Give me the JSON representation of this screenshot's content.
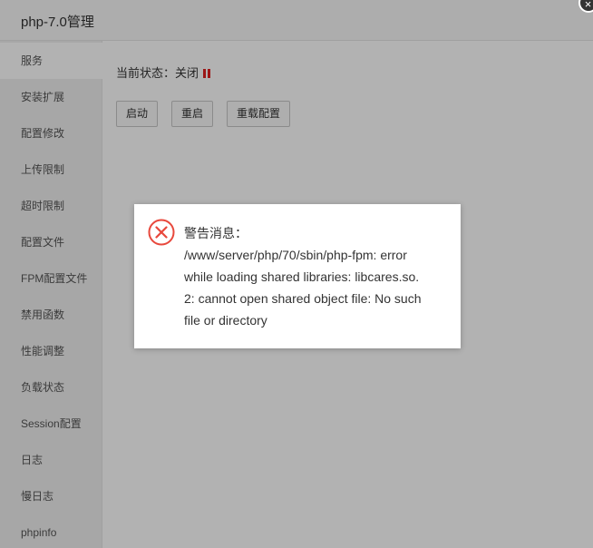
{
  "window": {
    "title": "php-7.0管理",
    "close_label": "×"
  },
  "sidebar": {
    "items": [
      {
        "label": "服务",
        "active": true
      },
      {
        "label": "安装扩展"
      },
      {
        "label": "配置修改"
      },
      {
        "label": "上传限制"
      },
      {
        "label": "超时限制"
      },
      {
        "label": "配置文件"
      },
      {
        "label": "FPM配置文件"
      },
      {
        "label": "禁用函数"
      },
      {
        "label": "性能调整"
      },
      {
        "label": "负载状态"
      },
      {
        "label": "Session配置"
      },
      {
        "label": "日志"
      },
      {
        "label": "慢日志"
      },
      {
        "label": "phpinfo"
      }
    ]
  },
  "service": {
    "status_label": "当前状态：",
    "status_value": "关闭",
    "status_icon": "pause-icon",
    "status_color": "#e02020",
    "buttons": {
      "start": "启动",
      "restart": "重启",
      "reload": "重载配置"
    }
  },
  "dialog": {
    "icon": "error-circle-icon",
    "icon_color": "#e8483c",
    "title": "警告消息：",
    "lines": [
      "/www/server/php/70/sbin/php-fpm: error",
      "while loading shared libraries: libcares.so.",
      "2: cannot open shared object file: No such",
      "file or directory"
    ]
  }
}
